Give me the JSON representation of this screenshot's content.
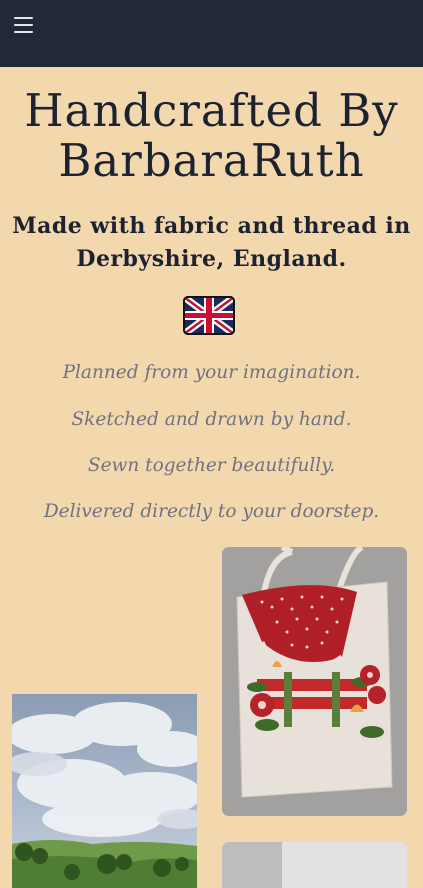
{
  "header": {
    "menu_icon": "hamburger-menu-icon"
  },
  "hero": {
    "title": "Handcrafted By BarbaraRuth",
    "subtitle": "Made with fabric and thread in Derbyshire, England.",
    "flag_icon": "union-jack-flag-icon"
  },
  "taglines": [
    "Planned from your imagination.",
    "Sketched and drawn by hand.",
    "Sewn together beautifully.",
    "Delivered directly to your doorstep."
  ],
  "gallery": {
    "photos": [
      "tote-bag-photo",
      "countryside-sky-photo",
      "gallery-photo-partial"
    ]
  },
  "colors": {
    "navbar": "#212838",
    "page_background": "#f3d8ad",
    "heading_text": "#1d2230",
    "tagline_text": "#6f7280"
  }
}
